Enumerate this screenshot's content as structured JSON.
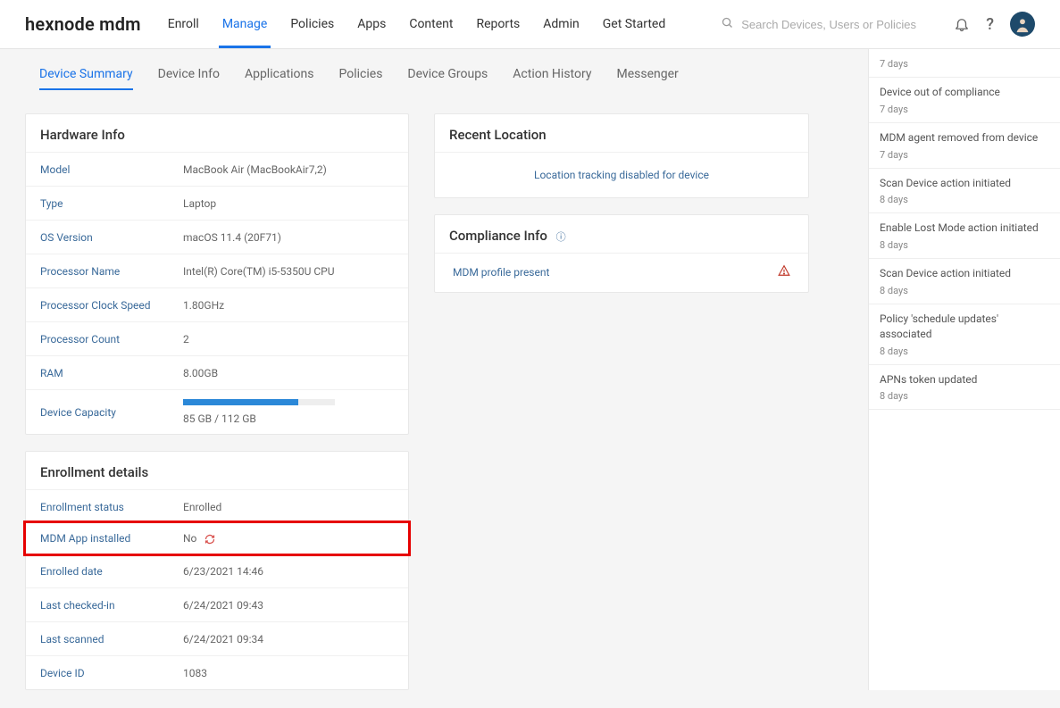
{
  "brand": "hexnode mdm",
  "nav": [
    "Enroll",
    "Manage",
    "Policies",
    "Apps",
    "Content",
    "Reports",
    "Admin",
    "Get Started"
  ],
  "nav_active": "Manage",
  "search_placeholder": "Search Devices, Users or Policies",
  "subtabs": [
    "Device Summary",
    "Device Info",
    "Applications",
    "Policies",
    "Device Groups",
    "Action History",
    "Messenger"
  ],
  "subtab_active": "Device Summary",
  "hardware": {
    "title": "Hardware Info",
    "rows": [
      {
        "key": "Model",
        "val": "MacBook Air (MacBookAir7,2)"
      },
      {
        "key": "Type",
        "val": "Laptop"
      },
      {
        "key": "OS Version",
        "val": "macOS 11.4 (20F71)"
      },
      {
        "key": "Processor Name",
        "val": "Intel(R) Core(TM) i5-5350U CPU"
      },
      {
        "key": "Processor Clock Speed",
        "val": "1.80GHz"
      },
      {
        "key": "Processor Count",
        "val": "2"
      },
      {
        "key": "RAM",
        "val": "8.00GB"
      }
    ],
    "capacity_key": "Device Capacity",
    "capacity_val": "85 GB / 112 GB"
  },
  "enrollment": {
    "title": "Enrollment details",
    "rows": [
      {
        "key": "Enrollment status",
        "val": "Enrolled"
      },
      {
        "key": "MDM App installed",
        "val": "No",
        "highlight": true,
        "refresh": true
      },
      {
        "key": "Enrolled date",
        "val": "6/23/2021 14:46"
      },
      {
        "key": "Last checked-in",
        "val": "6/24/2021 09:43"
      },
      {
        "key": "Last scanned",
        "val": "6/24/2021 09:34"
      },
      {
        "key": "Device ID",
        "val": "1083"
      }
    ]
  },
  "location": {
    "title": "Recent Location",
    "msg": "Location tracking disabled for device"
  },
  "compliance": {
    "title": "Compliance Info",
    "row_label": "MDM profile present"
  },
  "events": [
    {
      "title": "",
      "time": "7 days"
    },
    {
      "title": "Device out of compliance",
      "time": "7 days"
    },
    {
      "title": "MDM agent removed from device",
      "time": "7 days"
    },
    {
      "title": "Scan Device action initiated",
      "time": "8 days"
    },
    {
      "title": "Enable Lost Mode action initiated",
      "time": "8 days"
    },
    {
      "title": "Scan Device action initiated",
      "time": "8 days"
    },
    {
      "title": "Policy 'schedule updates' associated",
      "time": "8 days"
    },
    {
      "title": "APNs token updated",
      "time": "8 days"
    }
  ]
}
